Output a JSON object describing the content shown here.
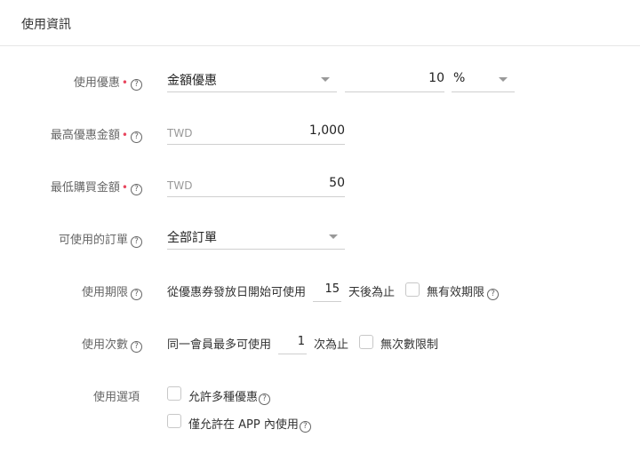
{
  "header": {
    "title": "使用資訊"
  },
  "discount": {
    "label": "使用優惠",
    "required_mark": "•",
    "help": "?",
    "type_value": "金額優惠",
    "amount_value": "10",
    "unit_value": "%"
  },
  "max_discount": {
    "label": "最高優惠金額",
    "required_mark": "•",
    "help": "?",
    "currency": "TWD",
    "value": "1,000"
  },
  "min_purchase": {
    "label": "最低購買金額",
    "required_mark": "•",
    "help": "?",
    "currency": "TWD",
    "value": "50"
  },
  "orders": {
    "label": "可使用的訂單",
    "help": "?",
    "value": "全部訂單"
  },
  "period": {
    "label": "使用期限",
    "help": "?",
    "prefix_text": "從優惠券發放日開始可使用",
    "days_value": "15",
    "suffix_text": "天後為止",
    "no_expiry_label": "無有效期限",
    "no_expiry_help": "?"
  },
  "usage_count": {
    "label": "使用次數",
    "help": "?",
    "prefix_text": "同一會員最多可使用",
    "count_value": "1",
    "suffix_text": "次為止",
    "unlimited_label": "無次數限制"
  },
  "options": {
    "label": "使用選項",
    "multi_discount_label": "允許多種優惠",
    "multi_discount_help": "?",
    "app_only_label": "僅允許在 APP 內使用",
    "app_only_help": "?"
  }
}
